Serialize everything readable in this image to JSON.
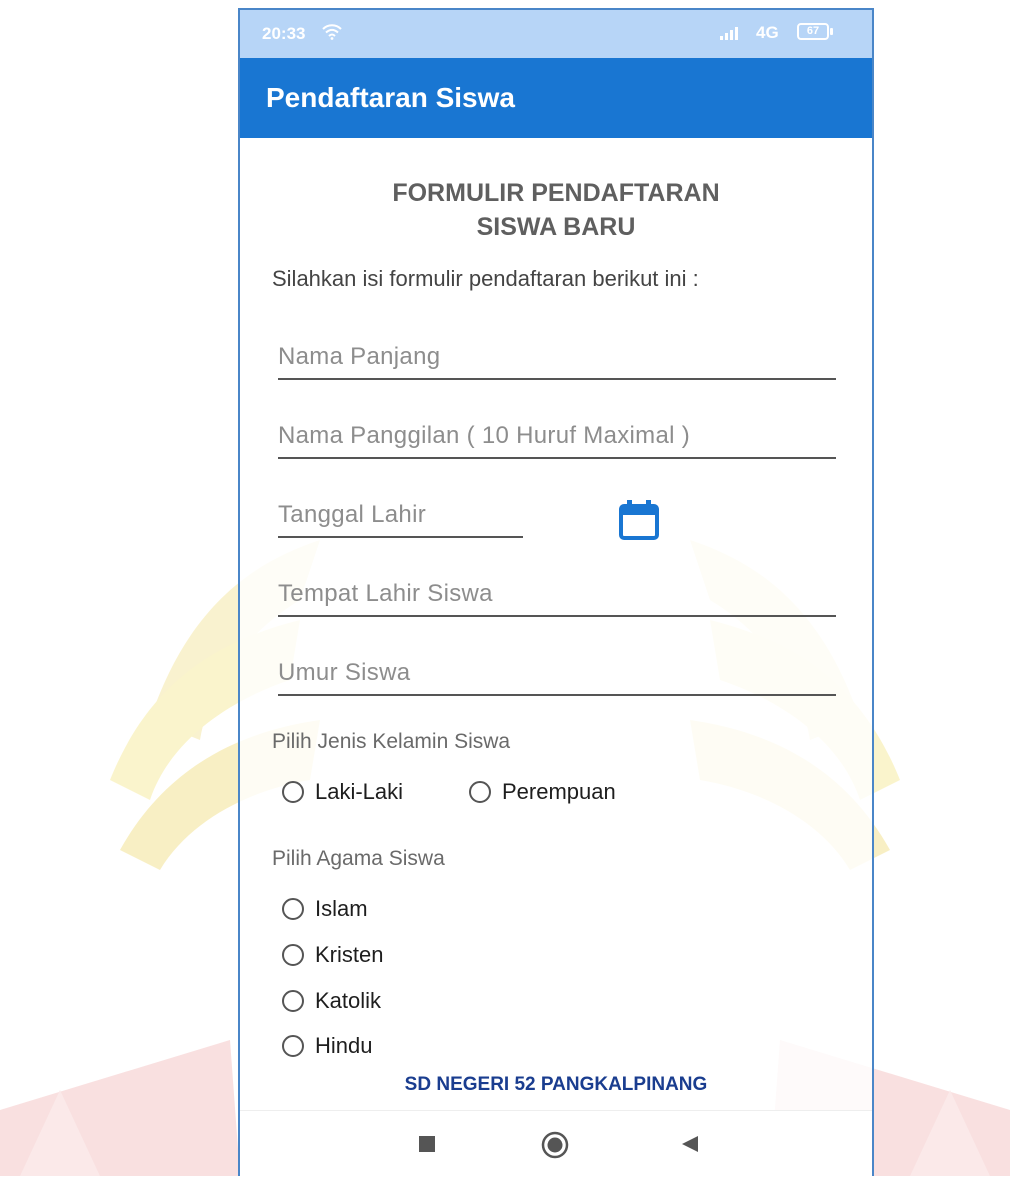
{
  "status_bar": {
    "time": "20:33",
    "network": "4G",
    "battery": "67"
  },
  "app_bar": {
    "title": "Pendaftaran Siswa"
  },
  "form": {
    "title_line1": "FORMULIR PENDAFTARAN",
    "title_line2": "SISWA BARU",
    "intro": "Silahkan isi formulir pendaftaran berikut ini :",
    "fields": {
      "nama_panjang": {
        "placeholder": "Nama Panjang",
        "value": ""
      },
      "nama_panggilan": {
        "placeholder": "Nama Panggilan ( 10 Huruf Maximal )",
        "value": ""
      },
      "tanggal_lahir": {
        "placeholder": "Tanggal Lahir",
        "value": ""
      },
      "tempat_lahir": {
        "placeholder": "Tempat Lahir Siswa",
        "value": ""
      },
      "umur": {
        "placeholder": "Umur Siswa",
        "value": ""
      }
    },
    "gender": {
      "label": "Pilih Jenis Kelamin Siswa",
      "options": [
        "Laki-Laki",
        "Perempuan"
      ],
      "selected": null
    },
    "religion": {
      "label": "Pilih Agama Siswa",
      "options": [
        "Islam",
        "Kristen",
        "Katolik",
        "Hindu"
      ],
      "selected": null
    }
  },
  "footer": {
    "school": "SD NEGERI 52 PANGKALPINANG"
  },
  "icons": {
    "calendar": "calendar-icon",
    "wifi": "wifi-icon",
    "signal": "signal-icon",
    "battery": "battery-icon"
  },
  "colors": {
    "primary": "#1976d2",
    "status_bar": "#b7d5f7",
    "footer_text": "#1a3d8f",
    "accent_icon": "#1976d2"
  }
}
